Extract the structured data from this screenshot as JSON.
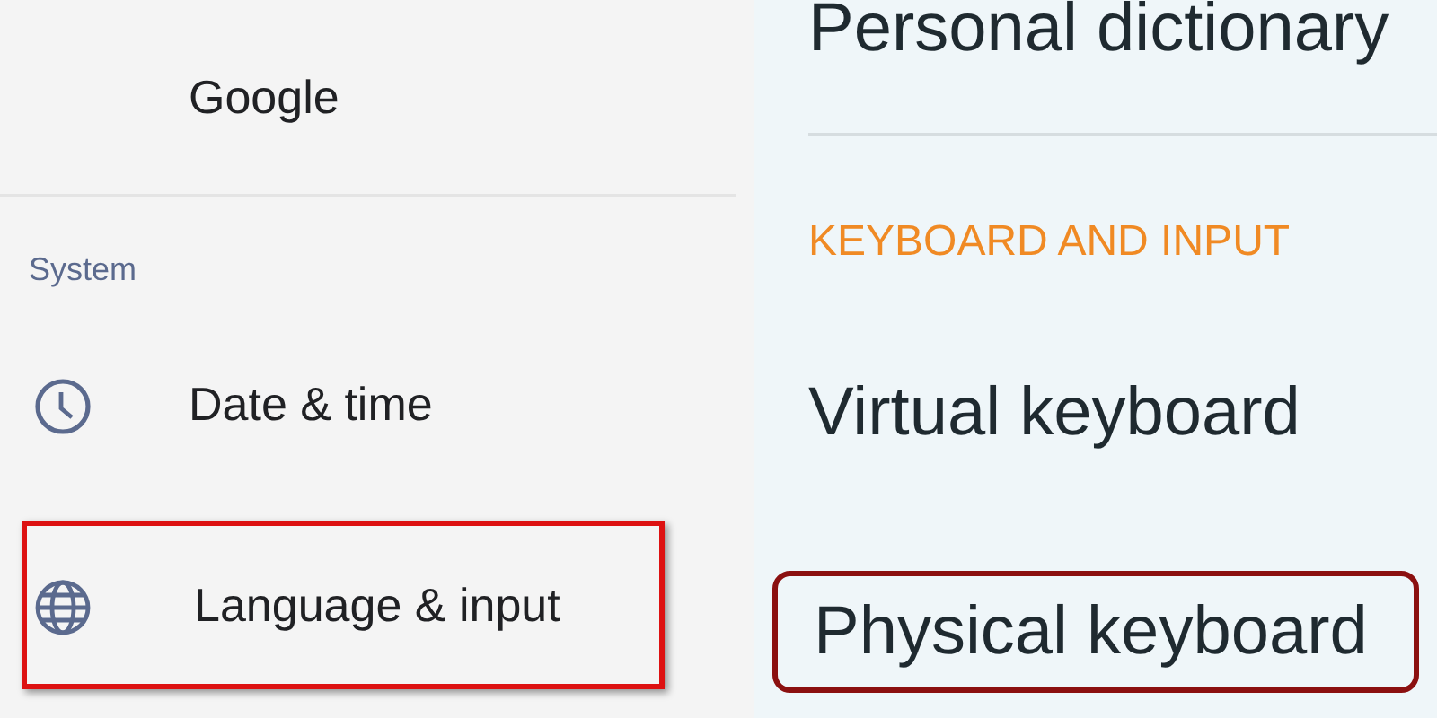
{
  "left_panel": {
    "items": [
      {
        "kind": "item",
        "label": "Google",
        "highlighted": false
      },
      {
        "kind": "header",
        "label": "System"
      },
      {
        "kind": "item",
        "label": "Date & time",
        "highlighted": false
      },
      {
        "kind": "item",
        "label": "Language & input",
        "highlighted": true
      }
    ]
  },
  "right_panel": {
    "items": [
      {
        "kind": "item",
        "label": "Personal dictionary",
        "highlighted": false
      },
      {
        "kind": "header",
        "label": "KEYBOARD AND INPUT"
      },
      {
        "kind": "item",
        "label": "Virtual keyboard",
        "highlighted": false
      },
      {
        "kind": "item",
        "label": "Physical keyboard",
        "highlighted": true
      }
    ]
  }
}
